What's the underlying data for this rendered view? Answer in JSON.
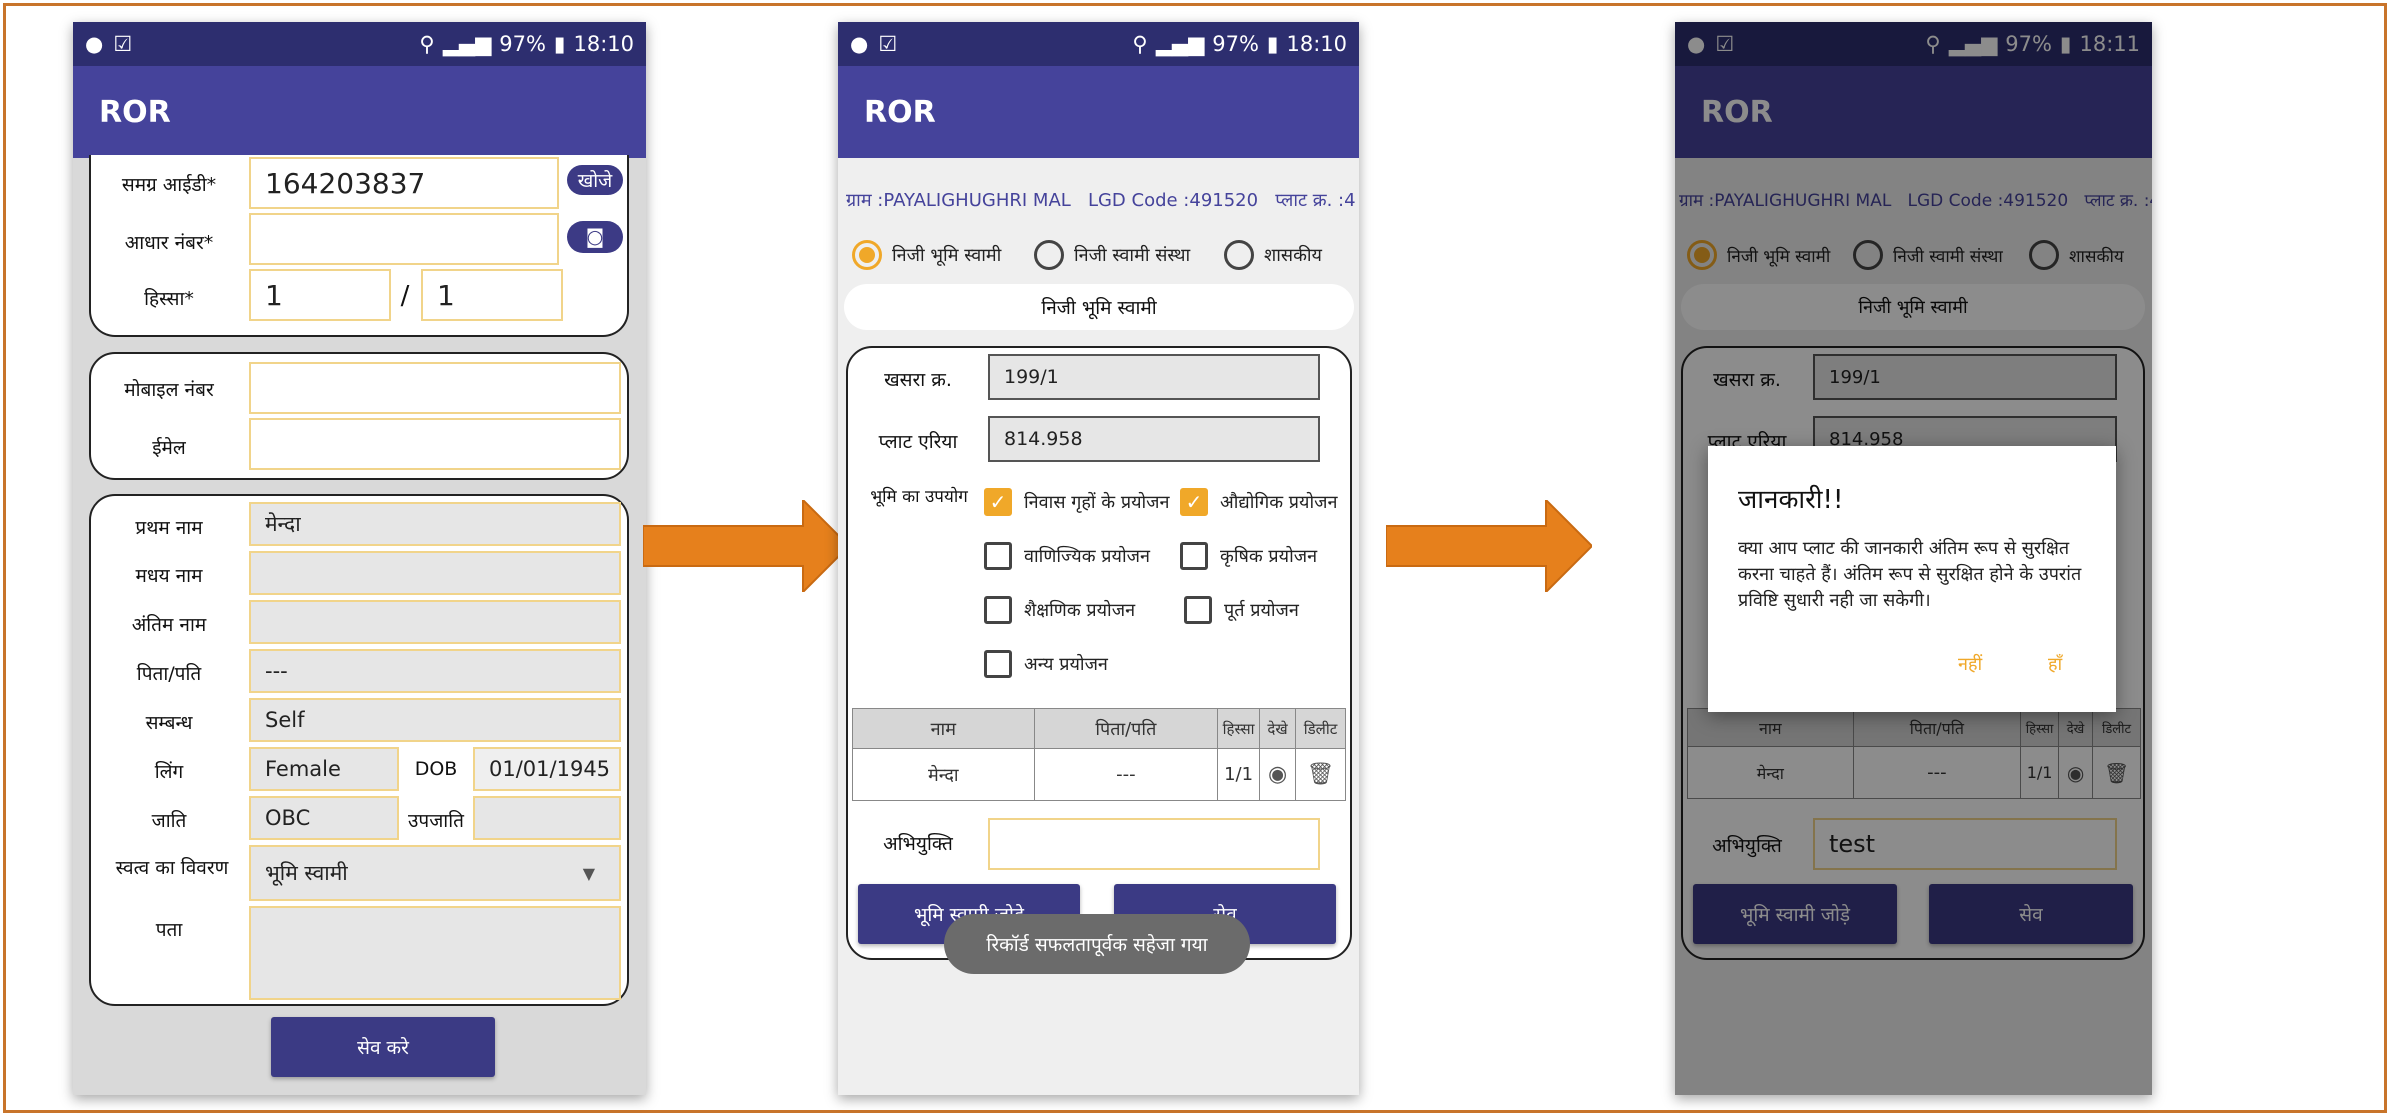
{
  "status": {
    "battery": "97%",
    "time1": "18:10",
    "time2": "18:10",
    "time3": "18:11"
  },
  "app_title": "ROR",
  "screen1": {
    "samagra_label": "समग्र आईडी*",
    "samagra_value": "164203837",
    "search_btn": "खोजे",
    "aadhar_label": "आधार नंबर*",
    "aadhar_value": "",
    "hissa_label": "हिस्सा*",
    "hissa_a": "1",
    "hissa_sep": "/",
    "hissa_b": "1",
    "mobile_label": "मोबाइल नंबर",
    "email_label": "ईमेल",
    "first_label": "प्रथम नाम",
    "first_value": "मेन्दा",
    "middle_label": "मधय नाम",
    "last_label": "अंतिम नाम",
    "father_label": "पिता/पति",
    "father_value": "---",
    "relation_label": "सम्बन्ध",
    "relation_value": "Self",
    "gender_label": "लिंग",
    "gender_value": "Female",
    "dob_label": "DOB",
    "dob_value": "01/01/1945",
    "caste_label": "जाति",
    "caste_value": "OBC",
    "subcaste_label": "उपजाति",
    "ownership_label": "स्वत्व का विवरण",
    "ownership_value": "भूमि स्वामी",
    "address_label": "पता",
    "save_btn": "सेव करे"
  },
  "screen2": {
    "info_line": "ग्राम :PAYALIGHUGHRI MAL   LGD Code :491520   प्लाट क्र. :4",
    "radio1": "निजी भूमि स्वामी",
    "radio2": "निजी स्वामी संस्था",
    "radio3": "शासकीय",
    "section_title": "निजी भूमि स्वामी",
    "khasra_label": "खसरा क्र.",
    "khasra_value": "199/1",
    "area_label": "प्लाट एरिया",
    "area_value": "814.958",
    "landuse_label": "भूमि का उपयोग",
    "cb1": "निवास गृहों के प्रयोजन",
    "cb2": "औद्योगिक प्रयोजन",
    "cb3": "वाणिज्यिक प्रयोजन",
    "cb4": "कृषिक प्रयोजन",
    "cb5": "शैक्षणिक प्रयोजन",
    "cb6": "पूर्त प्रयोजन",
    "cb7": "अन्य प्रयोजन",
    "col_name": "नाम",
    "col_father": "पिता/पति",
    "col_hissa": "हिस्सा",
    "col_view": "देखे",
    "col_delete": "डिलीट",
    "row_name": "मेन्दा",
    "row_father": "---",
    "row_hissa": "1/1",
    "remark_label": "अभियुक्ति",
    "add_btn": "भूमि स्वामी जोड़े",
    "save_btn": "सेव",
    "toast": "रिकॉर्ड सफलतापूर्वक सहेजा गया"
  },
  "screen3": {
    "remark_value": "test",
    "dialog_title": "जानकारी!!",
    "dialog_msg": "क्या आप प्लाट की जानकारी अंतिम रूप से सुरक्षित करना चाहते हैं। अंतिम रूप से सुरक्षित होने के उपरांत प्रविष्टि सुधारी नही जा सकेगी।",
    "no_btn": "नहीं",
    "yes_btn": "हाँ"
  },
  "colors": {
    "accent": "#f0a829",
    "primary": "#45439b",
    "status": "#2d2e6f",
    "arrow": "#e6801c"
  }
}
